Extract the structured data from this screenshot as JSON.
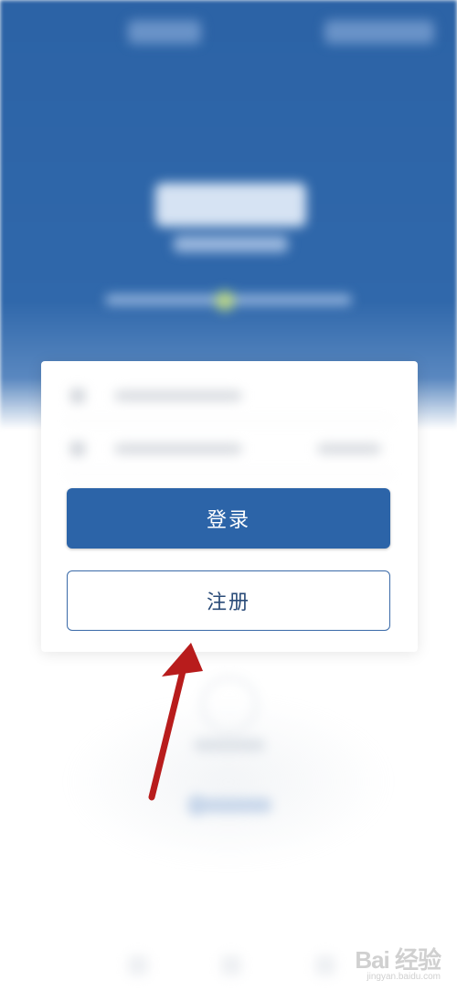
{
  "auth": {
    "login_label": "登录",
    "register_label": "注册"
  },
  "watermark": {
    "logo": "Bai 经验",
    "url": "jingyan.baidu.com"
  },
  "colors": {
    "primary": "#2c64a8",
    "register_border": "#3a6aa8",
    "annotation_arrow": "#b81c1c"
  }
}
